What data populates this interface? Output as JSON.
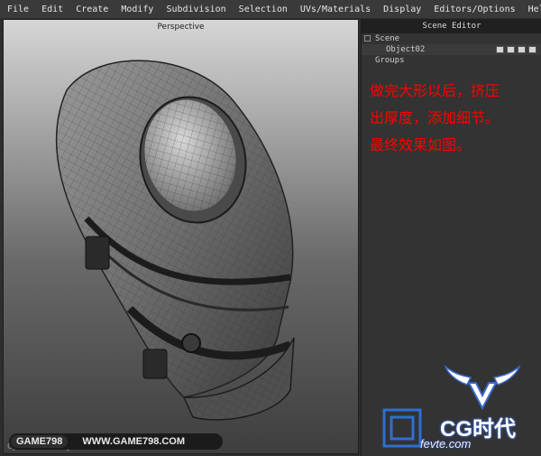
{
  "menu": [
    "File",
    "Edit",
    "Create",
    "Modify",
    "Subdivision",
    "Selection",
    "UVs/Materials",
    "Display",
    "Editors/Options",
    "Help"
  ],
  "viewport": {
    "label": "Perspective",
    "status": "Cycle Shading Reverse"
  },
  "scene_editor": {
    "title": "Scene Editor",
    "scene_label": "Scene",
    "object_label": "Object02",
    "groups_label": "Groups"
  },
  "note": {
    "line1": "做完大形以后，挤压",
    "line2": "出厚度，添加细节。",
    "line3": "最终效果如图。",
    "color": "#ff0000"
  },
  "watermarks": {
    "left_brand": "GAME798",
    "left_url": "WWW.GAME798.COM",
    "right_text": "CG时代",
    "right_url": "fevte.com"
  }
}
